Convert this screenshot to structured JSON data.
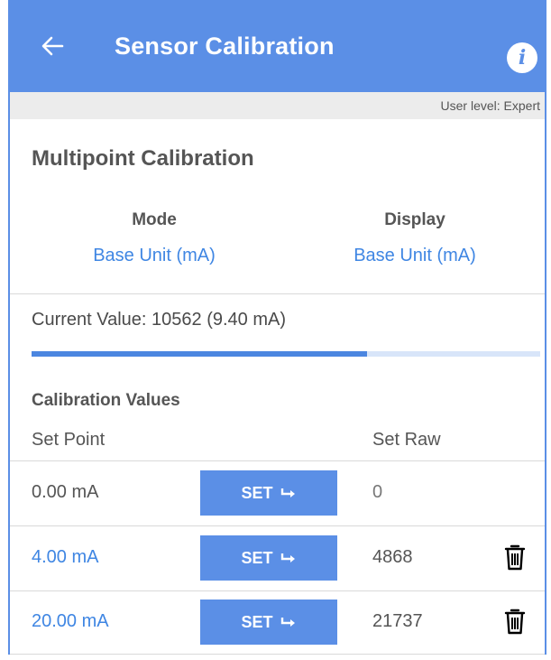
{
  "app_bar": {
    "title": "Sensor Calibration",
    "back_icon": "arrow-left-icon",
    "info_icon": "info-icon",
    "info_glyph": "i"
  },
  "user_level": "User level: Expert",
  "section_title": "Multipoint Calibration",
  "mode": {
    "label": "Mode",
    "value": "Base Unit (mA)"
  },
  "display": {
    "label": "Display",
    "value": "Base Unit (mA)"
  },
  "current_value": "Current Value: 10562 (9.40 mA)",
  "progress_fraction": 0.66,
  "calibration": {
    "title": "Calibration Values",
    "col_set_point": "Set Point",
    "col_set_raw": "Set Raw",
    "set_label": "SET",
    "set_icon": "arrow-right-curved-icon",
    "delete_icon": "trash-icon",
    "rows": [
      {
        "set_point": "0.00 mA",
        "set_raw": "0"
      },
      {
        "set_point": "4.00 mA",
        "set_raw": "4868"
      },
      {
        "set_point": "20.00 mA",
        "set_raw": "21737"
      }
    ]
  },
  "colors": {
    "primary": "#5b8fe6",
    "link": "#3f86e3",
    "progress_track": "#d8e5f9"
  }
}
